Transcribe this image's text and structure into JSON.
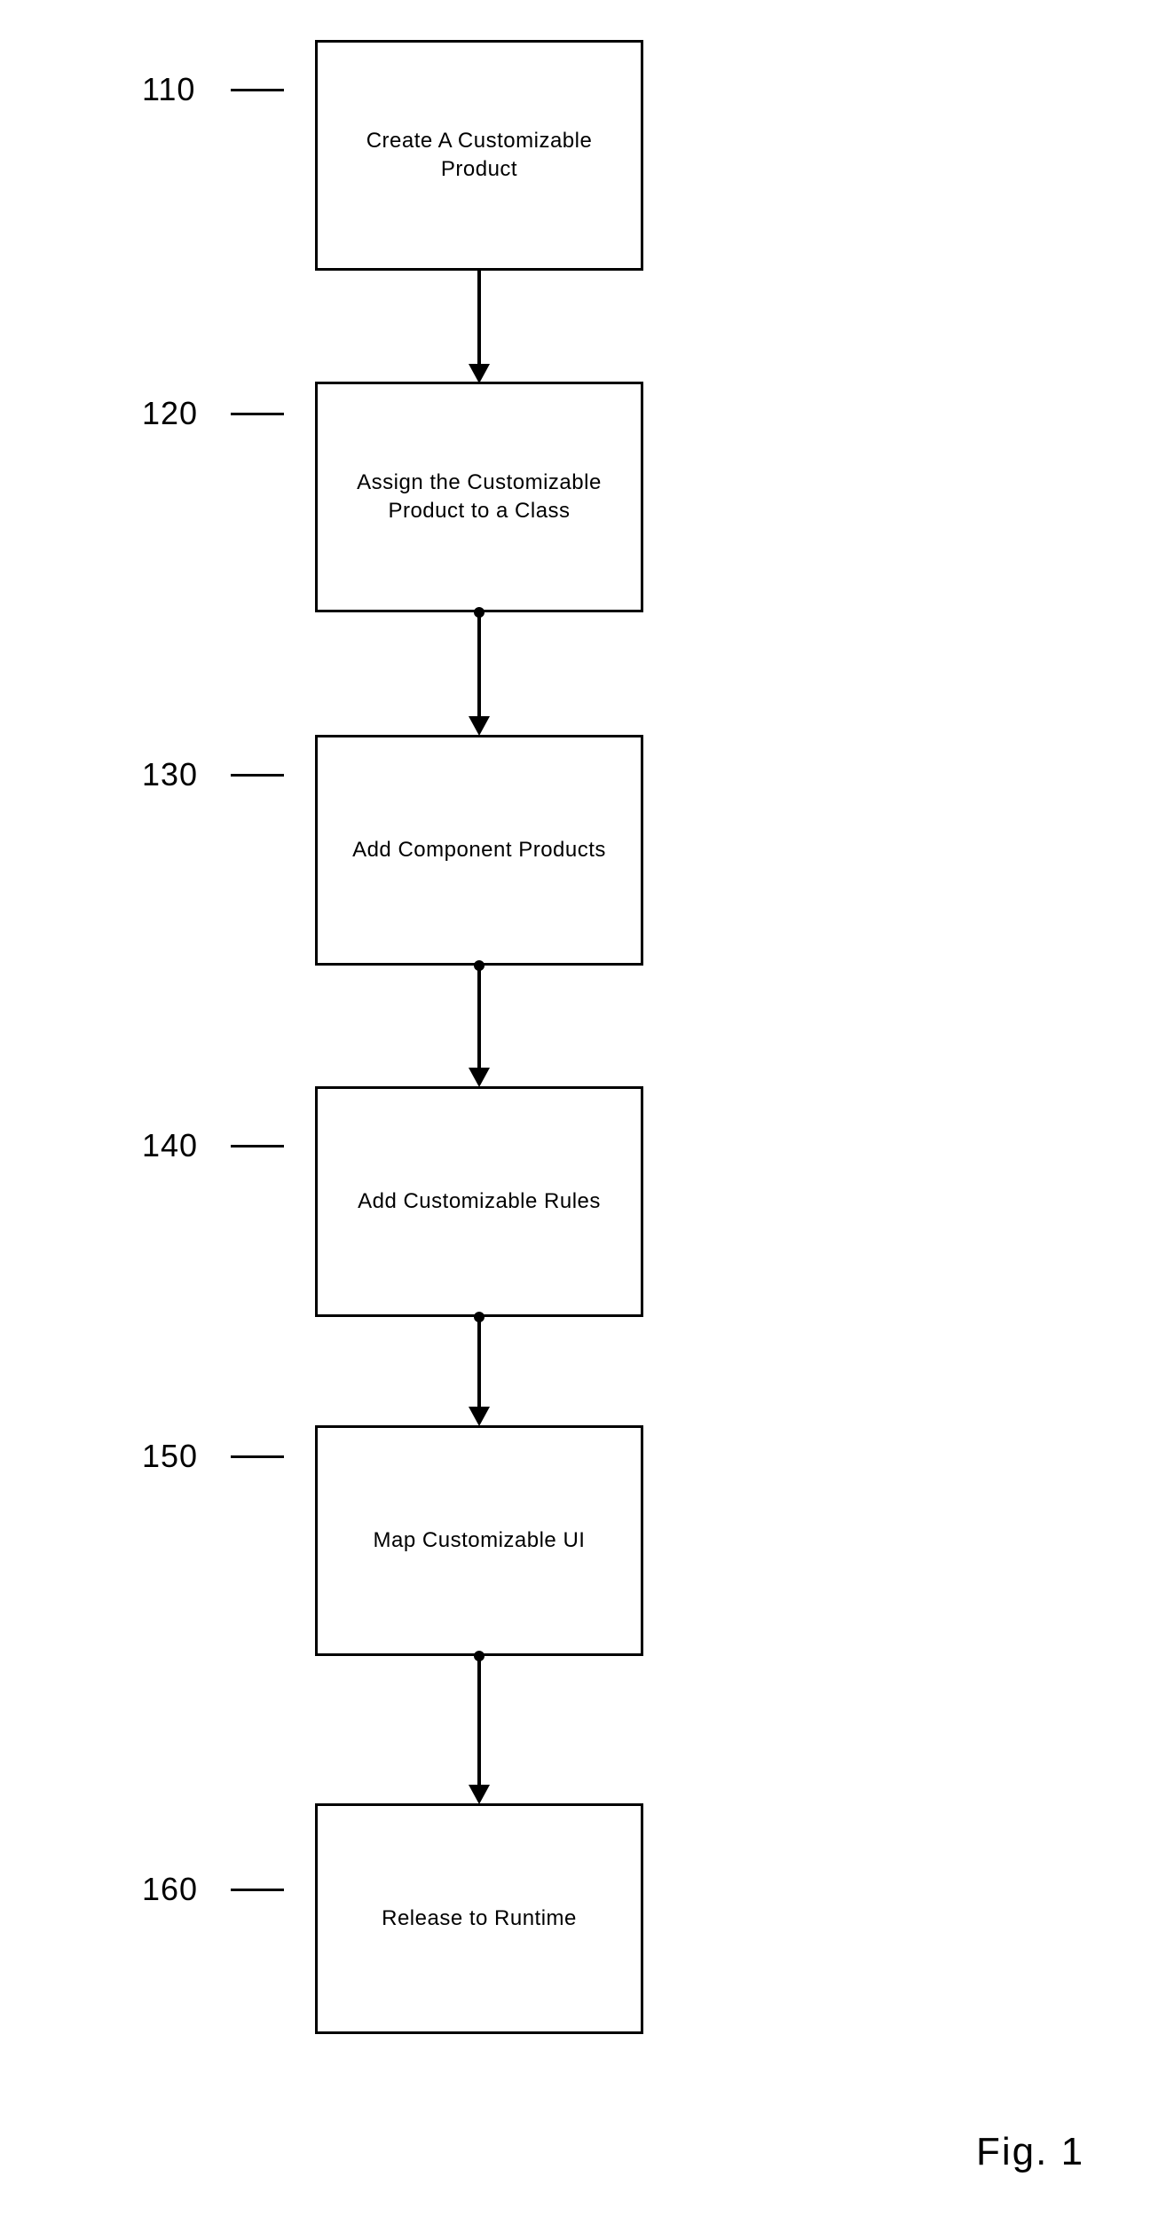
{
  "steps": [
    {
      "num": "110",
      "text": "Create A Customizable Product"
    },
    {
      "num": "120",
      "text": "Assign the Customizable Product to a Class"
    },
    {
      "num": "130",
      "text": "Add Component Products"
    },
    {
      "num": "140",
      "text": "Add Customizable Rules"
    },
    {
      "num": "150",
      "text": "Map Customizable UI"
    },
    {
      "num": "160",
      "text": "Release to Runtime"
    }
  ],
  "figure_caption": "Fig. 1"
}
